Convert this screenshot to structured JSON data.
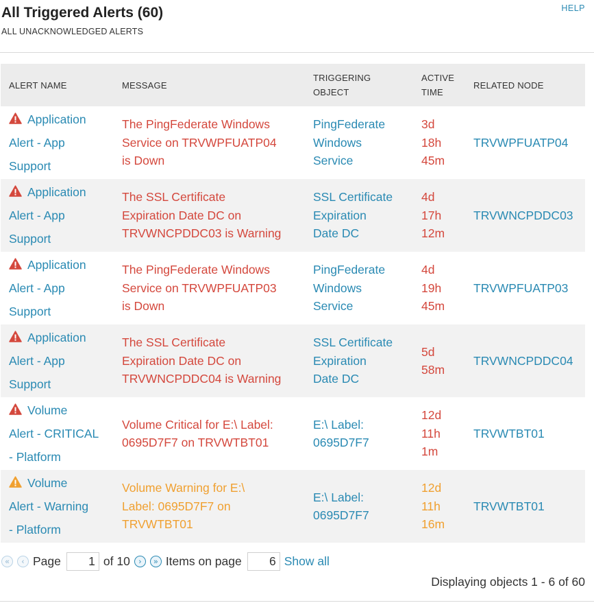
{
  "header": {
    "title": "All Triggered Alerts (60)",
    "subtitle": "ALL UNACKNOWLEDGED ALERTS",
    "help": "HELP"
  },
  "table": {
    "columns": [
      "ALERT NAME",
      "MESSAGE",
      "TRIGGERING OBJECT",
      "ACTIVE TIME",
      "RELATED NODE"
    ],
    "rows": [
      {
        "severity": "critical",
        "name_lines": [
          "Application",
          "Alert - App",
          "Support"
        ],
        "message_lines": [
          "The PingFederate Windows",
          "Service on TRVWPFUATP04",
          "is Down"
        ],
        "object_lines": [
          "PingFederate",
          "Windows",
          "Service"
        ],
        "time_lines": [
          "3d",
          "18h",
          "45m"
        ],
        "node": "TRVWPFUATP04"
      },
      {
        "severity": "critical",
        "name_lines": [
          "Application",
          "Alert - App",
          "Support"
        ],
        "message_lines": [
          "The SSL Certificate",
          "Expiration Date DC on",
          "TRVWNCPDDC03 is Warning"
        ],
        "object_lines": [
          "SSL Certificate",
          "Expiration",
          "Date DC"
        ],
        "time_lines": [
          "4d",
          "17h",
          "12m"
        ],
        "node": "TRVWNCPDDC03"
      },
      {
        "severity": "critical",
        "name_lines": [
          "Application",
          "Alert - App",
          "Support"
        ],
        "message_lines": [
          "The PingFederate Windows",
          "Service on TRVWPFUATP03",
          "is Down"
        ],
        "object_lines": [
          "PingFederate",
          "Windows",
          "Service"
        ],
        "time_lines": [
          "4d",
          "19h",
          "45m"
        ],
        "node": "TRVWPFUATP03"
      },
      {
        "severity": "critical",
        "name_lines": [
          "Application",
          "Alert - App",
          "Support"
        ],
        "message_lines": [
          "The SSL Certificate",
          "Expiration Date DC on",
          "TRVWNCPDDC04 is Warning"
        ],
        "object_lines": [
          "SSL Certificate",
          "Expiration",
          "Date DC"
        ],
        "time_lines": [
          "5d",
          "58m"
        ],
        "node": "TRVWNCPDDC04"
      },
      {
        "severity": "critical",
        "name_lines": [
          "Volume",
          "Alert - CRITICAL",
          "- Platform"
        ],
        "message_lines": [
          "Volume Critical for E:\\ Label:",
          "0695D7F7 on TRVWTBT01"
        ],
        "object_lines": [
          "E:\\ Label:",
          "0695D7F7"
        ],
        "time_lines": [
          "12d",
          "11h",
          "1m"
        ],
        "node": "TRVWTBT01"
      },
      {
        "severity": "warning",
        "name_lines": [
          "Volume",
          "Alert - Warning",
          "- Platform"
        ],
        "message_lines": [
          "Volume Warning for E:\\",
          "Label: 0695D7F7 on",
          "TRVWTBT01"
        ],
        "object_lines": [
          "E:\\ Label:",
          "0695D7F7"
        ],
        "time_lines": [
          "12d",
          "11h",
          "16m"
        ],
        "node": "TRVWTBT01"
      }
    ]
  },
  "pager": {
    "page_label": "Page",
    "page_value": "1",
    "of_label": "of 10",
    "items_label": "Items on page",
    "items_value": "6",
    "show_all": "Show all",
    "displaying": "Displaying objects 1 - 6 of 60"
  },
  "colors": {
    "critical": "#d4483d",
    "warning": "#f0a030",
    "link": "#2a8ab3"
  },
  "icons": {
    "critical": "warning-triangle-red-icon",
    "warning": "warning-triangle-orange-icon",
    "first": "first-page-icon",
    "prev": "previous-page-icon",
    "next": "next-page-icon",
    "last": "last-page-icon"
  }
}
